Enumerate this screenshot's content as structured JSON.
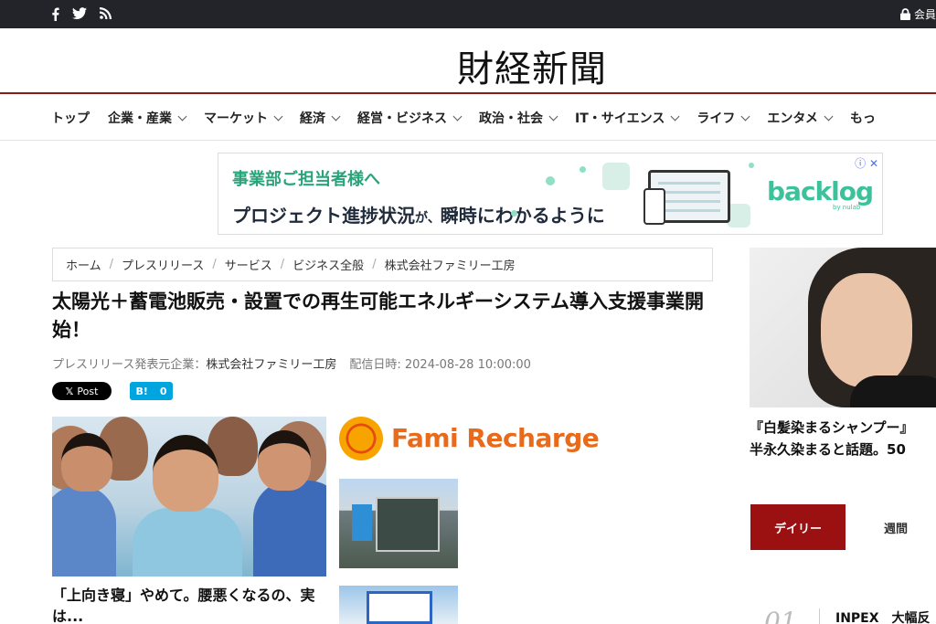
{
  "topbar": {
    "member_label": "会員"
  },
  "masthead": {
    "logo_text": "財経新聞"
  },
  "nav": {
    "items": [
      {
        "label": "トップ",
        "has_dropdown": false
      },
      {
        "label": "企業・産業",
        "has_dropdown": true
      },
      {
        "label": "マーケット",
        "has_dropdown": true
      },
      {
        "label": "経済",
        "has_dropdown": true
      },
      {
        "label": "経営・ビジネス",
        "has_dropdown": true
      },
      {
        "label": "政治・社会",
        "has_dropdown": true
      },
      {
        "label": "IT・サイエンス",
        "has_dropdown": true
      },
      {
        "label": "ライフ",
        "has_dropdown": true
      },
      {
        "label": "エンタメ",
        "has_dropdown": true
      },
      {
        "label": "もっ",
        "has_dropdown": false
      }
    ]
  },
  "ad_banner": {
    "headline": "事業部ご担当者様へ",
    "body_main_1": "プロジェクト進捗状況",
    "body_small": "が、",
    "body_main_2": "瞬時にわかるように",
    "brand": "backlog",
    "brand_sub": "by nulab",
    "close_glyph": "ⓘ ✕"
  },
  "breadcrumb": {
    "items": [
      "ホーム",
      "プレスリリース",
      "サービス",
      "ビジネス全般",
      "株式会社ファミリー工房"
    ]
  },
  "article": {
    "title": "太陽光＋蓄電池販売・設置での再生可能エネルギーシステム導入支援事業開始！",
    "publisher_label": "プレスリリース発表元企業：",
    "publisher": "株式会社ファミリー工房",
    "date_label": "配信日時: 2024-08-28 10:00:00"
  },
  "share": {
    "x_post_label": "Post",
    "hatena_label": "B!",
    "hatena_count": "0"
  },
  "image_ad": {
    "caption": "「上向き寝」やめて。腰悪くなるの、実は..."
  },
  "fami": {
    "logo_text": "Fami Recharge"
  },
  "right_column": {
    "caption_line1": "『白髪染まるシャンプー』",
    "caption_line2": "半永久染まると話題。50",
    "tabs": [
      "デイリー",
      "週間"
    ],
    "ranking": [
      {
        "num": "01",
        "text": "INPEX　大幅反"
      }
    ]
  },
  "colors": {
    "topbar_bg": "#23242a",
    "accent_red": "#9b1010",
    "ad_green": "#28a37a",
    "hatena_blue": "#00a4de",
    "fami_orange": "#e86a1a"
  },
  "icons": [
    "facebook-icon",
    "twitter-icon",
    "rss-icon",
    "lock-icon"
  ]
}
